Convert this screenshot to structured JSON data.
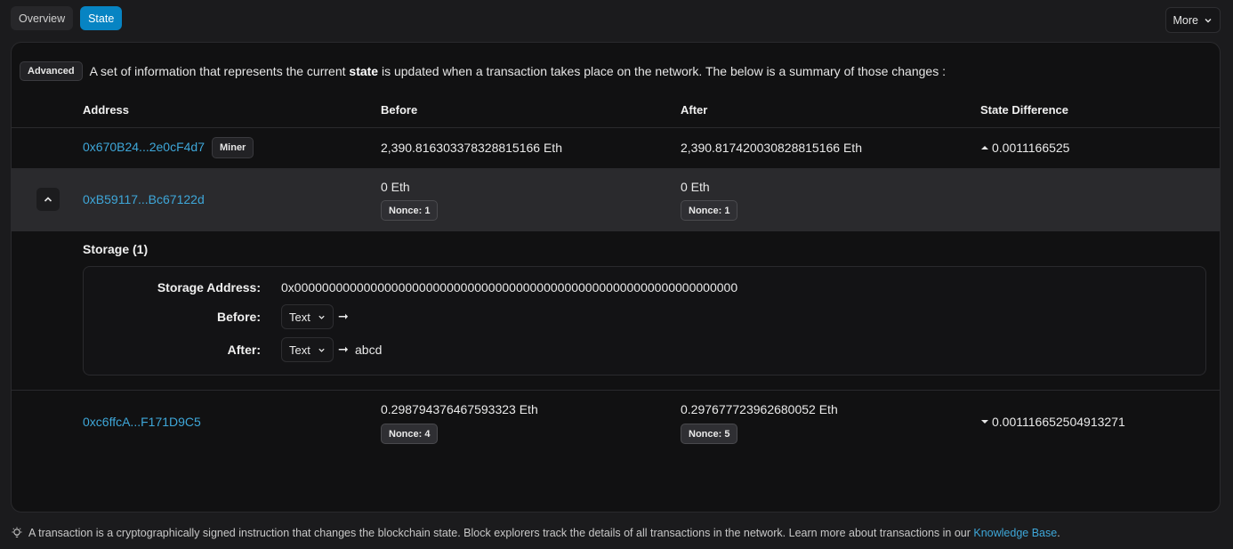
{
  "tabs": [
    {
      "label": "Overview"
    },
    {
      "label": "State"
    }
  ],
  "more_label": "More",
  "intro": {
    "badge": "Advanced",
    "text_before": "A set of information that represents the current ",
    "text_bold": "state",
    "text_after": " is updated when a transaction takes place on the network. The below is a summary of those changes :"
  },
  "headers": {
    "address": "Address",
    "before": "Before",
    "after": "After",
    "diff": "State Difference"
  },
  "rows": [
    {
      "address": "0x670B24...2e0cF4d7",
      "badge": "Miner",
      "before": "2,390.816303378328815166 Eth",
      "after": "2,390.817420030828815166 Eth",
      "diff": "0.0011166525",
      "diff_direction": "up"
    },
    {
      "address": "0xB59117...Bc67122d",
      "before": "0 Eth",
      "before_nonce": "Nonce: 1",
      "after": "0 Eth",
      "after_nonce": "Nonce: 1"
    },
    {
      "address": "0xc6ffcA...F171D9C5",
      "before": "0.298794376467593323 Eth",
      "before_nonce": "Nonce: 4",
      "after": "0.297677723962680052 Eth",
      "after_nonce": "Nonce: 5",
      "diff": "0.001116652504913271",
      "diff_direction": "down"
    }
  ],
  "storage": {
    "title": "Storage (1)",
    "address_label": "Storage Address:",
    "address_value": "0x0000000000000000000000000000000000000000000000000000000000000000",
    "before_label": "Before:",
    "before_format": "Text",
    "before_value": "",
    "after_label": "After:",
    "after_format": "Text",
    "after_value": "abcd"
  },
  "footer": {
    "text": "A transaction is a cryptographically signed instruction that changes the blockchain state. Block explorers track the details of all transactions in the network. Learn more about transactions in our ",
    "link": "Knowledge Base",
    "end": "."
  },
  "colors": {
    "accent": "#0784c3",
    "link": "#3ea7d9",
    "background": "#1b1b1d",
    "card": "#111112"
  }
}
